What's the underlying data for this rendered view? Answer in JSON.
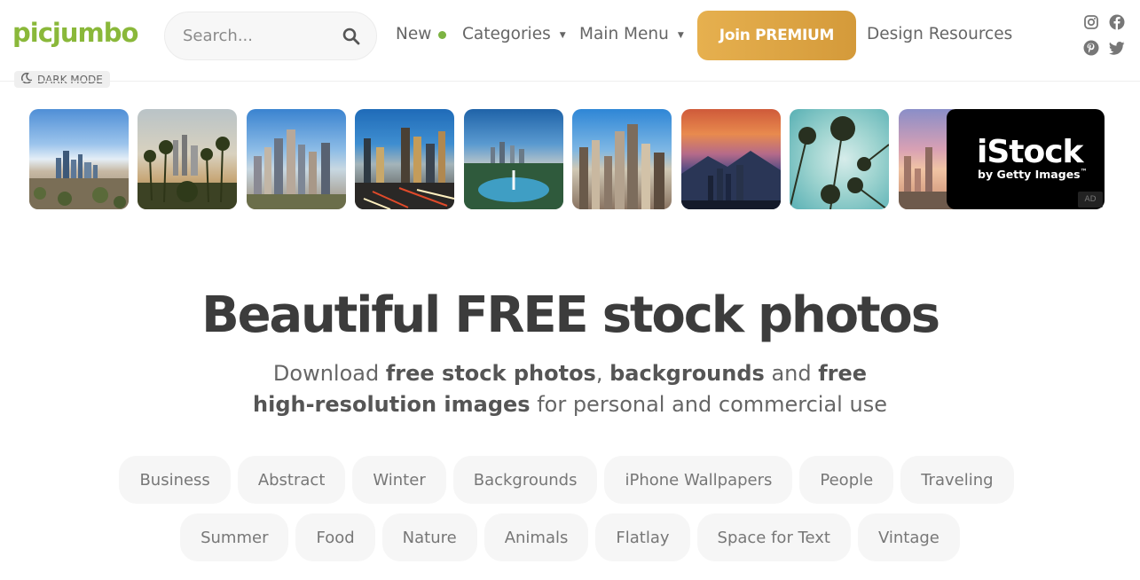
{
  "header": {
    "logo": "picjumbo",
    "search_placeholder": "Search...",
    "nav": {
      "new": "New",
      "categories": "Categories",
      "main_menu": "Main Menu",
      "premium": "Join PREMIUM",
      "resources": "Design Resources"
    },
    "dark_mode": "DARK MODE",
    "colors": {
      "brand": "#8ab83a",
      "premium": "#e0a848",
      "new_dot": "#7cb342"
    }
  },
  "thumbnails": [
    "los-angeles-skyline-1",
    "los-angeles-palms",
    "los-angeles-downtown",
    "los-angeles-freeway",
    "los-angeles-lake",
    "los-angeles-aerial",
    "los-angeles-sunset",
    "palm-trees-sky",
    "los-angeles-dusk"
  ],
  "ad": {
    "brand": "iStock",
    "tagline": "by Getty Images",
    "tm": "™",
    "badge": "AD"
  },
  "hero": {
    "title": "Beautiful FREE stock photos",
    "sub_1": "Download ",
    "sub_2": "free stock photos",
    "sub_3": ", ",
    "sub_4": "backgrounds",
    "sub_5": " and ",
    "sub_6": "free high-resolution images",
    "sub_7": " for personal and commercial use"
  },
  "tags": {
    "row1": [
      "Business",
      "Abstract",
      "Winter",
      "Backgrounds",
      "iPhone Wallpapers",
      "People",
      "Traveling"
    ],
    "row2": [
      "Summer",
      "Food",
      "Nature",
      "Animals",
      "Flatlay",
      "Space for Text",
      "Vintage"
    ]
  }
}
